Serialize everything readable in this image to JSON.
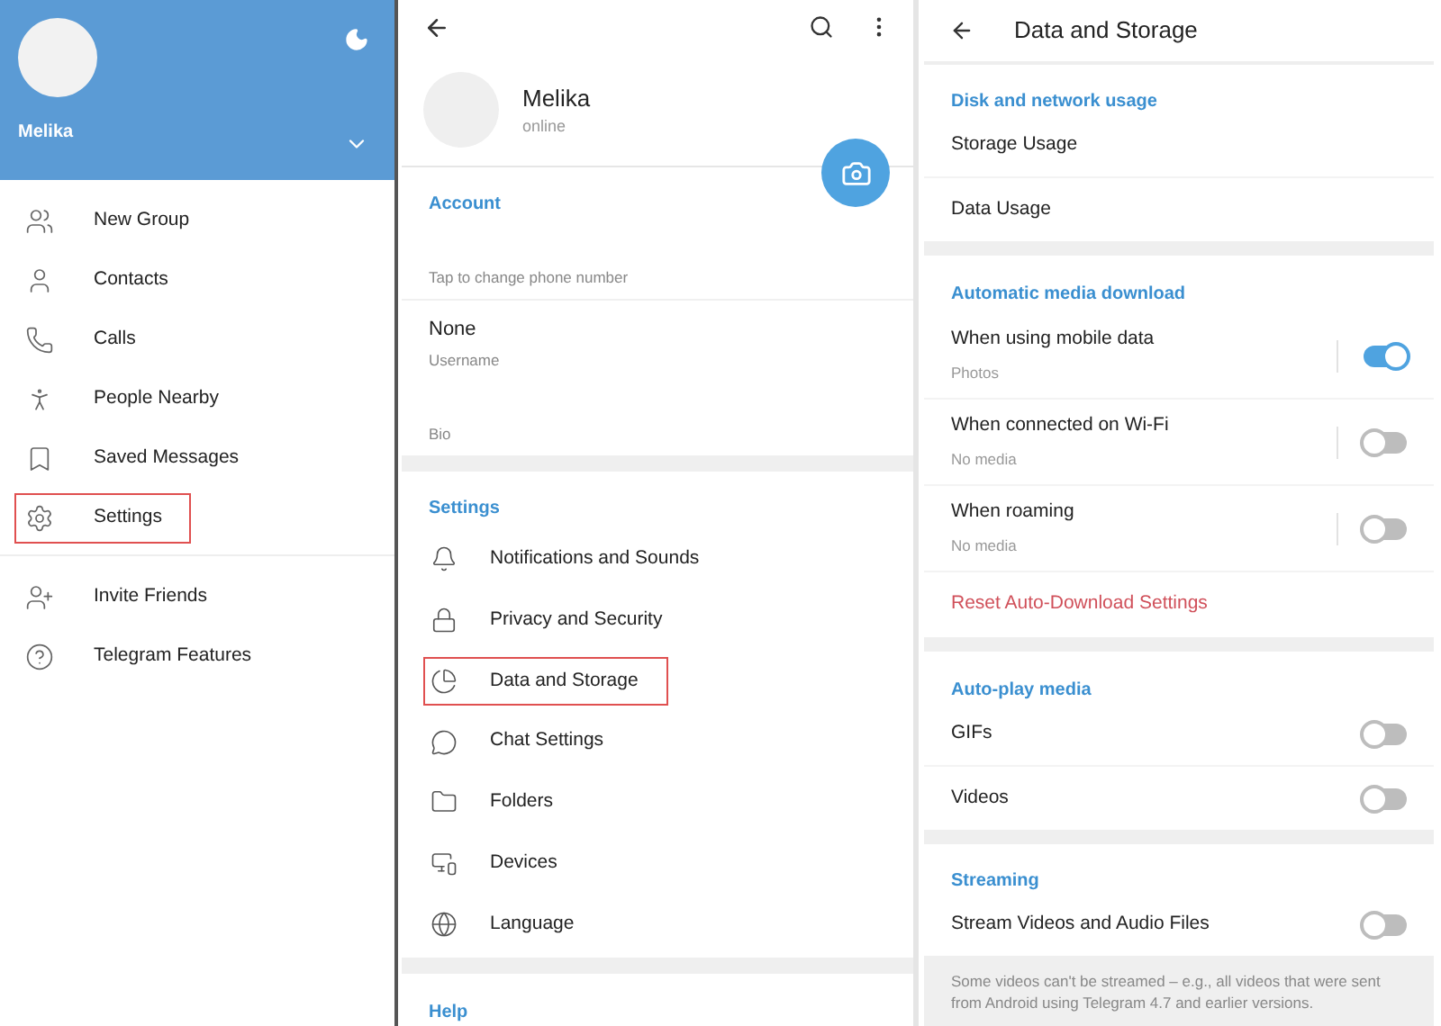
{
  "drawer": {
    "user_name": "Melika",
    "menu": [
      {
        "label": "New Group",
        "highlighted": false
      },
      {
        "label": "Contacts",
        "highlighted": false
      },
      {
        "label": "Calls",
        "highlighted": false
      },
      {
        "label": "People Nearby",
        "highlighted": false
      },
      {
        "label": "Saved Messages",
        "highlighted": false
      },
      {
        "label": "Settings",
        "highlighted": true
      }
    ],
    "menu_extra": [
      {
        "label": "Invite Friends",
        "highlighted": false
      },
      {
        "label": "Telegram Features",
        "highlighted": false
      }
    ]
  },
  "settings_screen": {
    "profile": {
      "name": "Melika",
      "status": "online"
    },
    "account": {
      "title": "Account",
      "phone_hint": "Tap to change phone number",
      "username_value": "None",
      "username_label": "Username",
      "bio_label": "Bio"
    },
    "settings": {
      "title": "Settings",
      "items": [
        {
          "label": "Notifications and Sounds",
          "highlighted": false
        },
        {
          "label": "Privacy and Security",
          "highlighted": false
        },
        {
          "label": "Data and Storage",
          "highlighted": true
        },
        {
          "label": "Chat Settings",
          "highlighted": false
        },
        {
          "label": "Folders",
          "highlighted": false
        },
        {
          "label": "Devices",
          "highlighted": false
        },
        {
          "label": "Language",
          "highlighted": false
        }
      ]
    },
    "help": {
      "title": "Help"
    }
  },
  "data_storage": {
    "title": "Data and Storage",
    "disk": {
      "title": "Disk and network usage",
      "items": [
        "Storage Usage",
        "Data Usage"
      ]
    },
    "auto_download": {
      "title": "Automatic media download",
      "rows": [
        {
          "title": "When using mobile data",
          "subtitle": "Photos",
          "on": true
        },
        {
          "title": "When connected on Wi-Fi",
          "subtitle": "No media",
          "on": false
        },
        {
          "title": "When roaming",
          "subtitle": "No media",
          "on": false
        }
      ],
      "reset": "Reset Auto-Download Settings"
    },
    "autoplay": {
      "title": "Auto-play media",
      "rows": [
        {
          "label": "GIFs",
          "on": false
        },
        {
          "label": "Videos",
          "on": false
        }
      ]
    },
    "streaming": {
      "title": "Streaming",
      "rows": [
        {
          "label": "Stream Videos and Audio Files",
          "on": false
        }
      ],
      "note": "Some videos can't be streamed – e.g., all videos that were sent from Android using Telegram 4.7 and earlier versions."
    }
  }
}
